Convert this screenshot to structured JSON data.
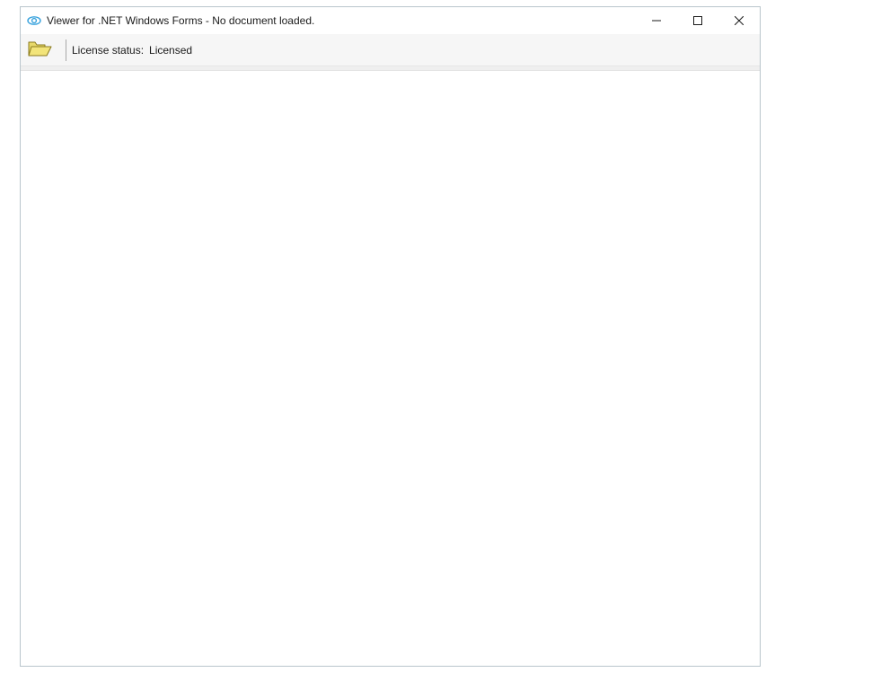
{
  "titlebar": {
    "title": "Viewer for .NET Windows Forms - No document loaded."
  },
  "toolbar": {
    "license_label": "License status:",
    "license_value": "Licensed"
  }
}
